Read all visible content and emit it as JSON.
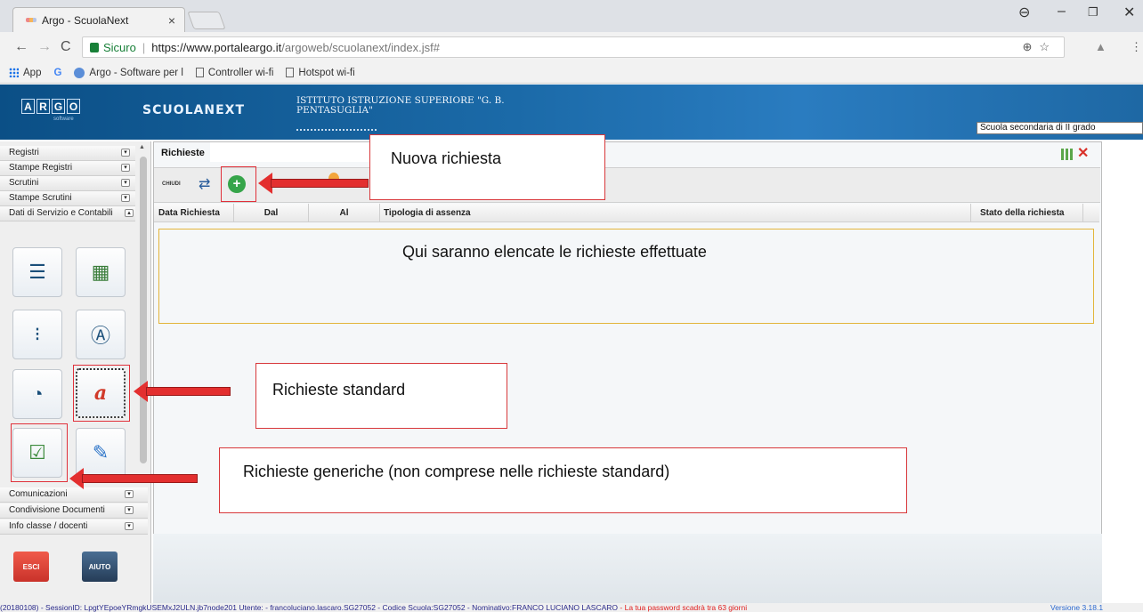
{
  "browser": {
    "tab_title": "Argo - ScuolaNext",
    "tab_close": "×",
    "secure_label": "Sicuro",
    "url_host": "https://www.portaleargo.it",
    "url_path": "/argoweb/scuolanext/index.jsf#",
    "bookmarks": [
      "App",
      "G",
      "Argo - Software per l",
      "Controller wi-fi",
      "Hotspot wi-fi"
    ]
  },
  "header": {
    "logo": [
      "A",
      "R",
      "G",
      "O"
    ],
    "logo_sub": "software",
    "brand": "SCUOLANEXT",
    "institute": "ISTITUTO ISTRUZIONE SUPERIORE \"G. B. PENTASUGLIA\"",
    "school_level": "Scuola secondaria di II grado"
  },
  "sidebar": {
    "menu_top": [
      "Registri",
      "Stampe Registri",
      "Scrutini",
      "Stampe Scrutini",
      "Dati di Servizio e Contabili"
    ],
    "menu_bottom": [
      "Comunicazioni",
      "Condivisione Documenti",
      "Info classe / docenti"
    ],
    "exit_label": "ESCI",
    "help_label": "AIUTO"
  },
  "panel": {
    "title": "Richieste",
    "close_label": "CHIUDI",
    "columns": [
      "Data Richiesta",
      "Dal",
      "Al",
      "Tipologia di assenza",
      "Stato della richiesta"
    ]
  },
  "annotations": {
    "new_request": "Nuova richiesta",
    "list_note": "Qui saranno elencate le richieste effettuate",
    "standard": "Richieste standard",
    "generic": "Richieste generiche (non comprese nelle richieste standard)"
  },
  "status": {
    "session": "(20180108) - SessionID: LpgtYEpoeYRmgkUSEMxJ2ULN.jb7node201 Utente: - francoluciano.lascaro.SG27052 - Codice Scuola:SG27052 - Nominativo:FRANCO LUCIANO LASCARO",
    "warning": "- La tua password scadrà tra 63 giorni",
    "version": "Versione 3.18.1"
  }
}
